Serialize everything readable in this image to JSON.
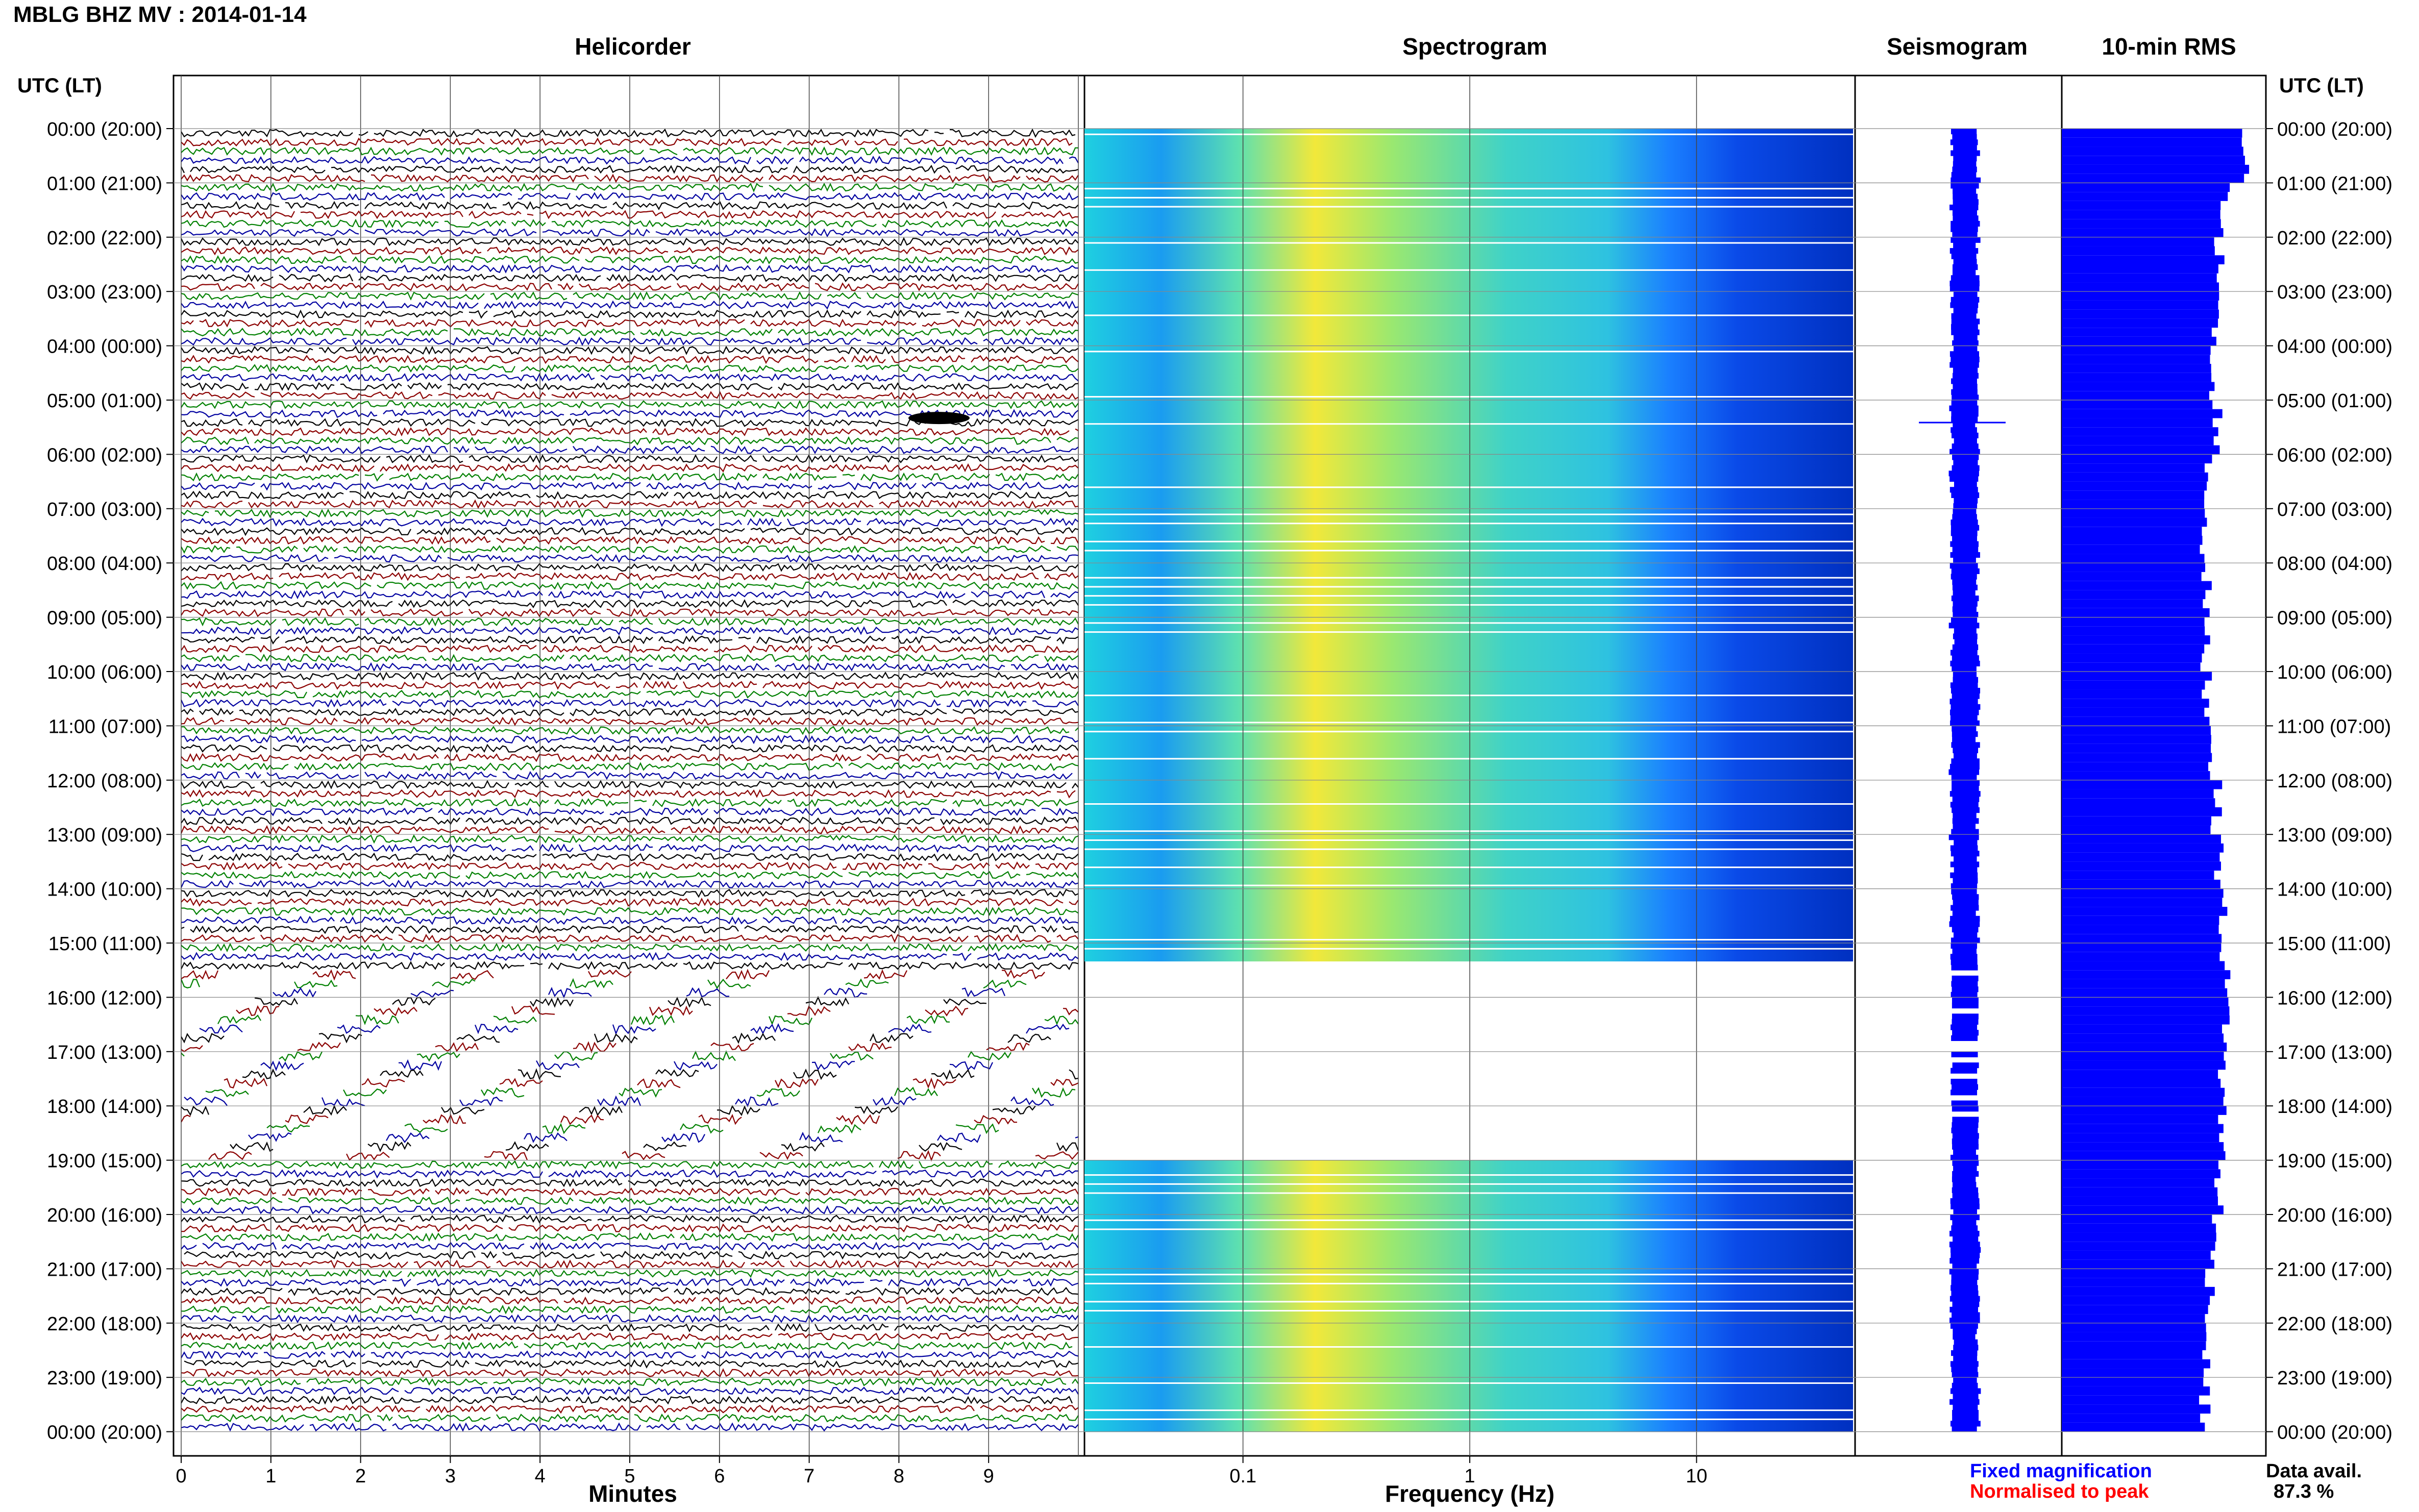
{
  "header": {
    "title": "MBLG BHZ MV : 2014-01-14"
  },
  "panels": {
    "helicorder": "Helicorder",
    "spectrogram": "Spectrogram",
    "seismogram": "Seismogram",
    "rms": "10-min RMS"
  },
  "axes": {
    "time_header": "UTC (LT)",
    "minutes_label": "Minutes",
    "frequency_label": "Frequency (Hz)",
    "minute_ticks": [
      "0",
      "1",
      "2",
      "3",
      "4",
      "5",
      "6",
      "7",
      "8",
      "9"
    ],
    "frequency_ticks": [
      "0.1",
      "1",
      "10"
    ],
    "time_labels": [
      "00:00 (20:00)",
      "01:00 (21:00)",
      "02:00 (22:00)",
      "03:00 (23:00)",
      "04:00 (00:00)",
      "05:00 (01:00)",
      "06:00 (02:00)",
      "07:00 (03:00)",
      "08:00 (04:00)",
      "09:00 (05:00)",
      "10:00 (06:00)",
      "11:00 (07:00)",
      "12:00 (08:00)",
      "13:00 (09:00)",
      "14:00 (10:00)",
      "15:00 (11:00)",
      "16:00 (12:00)",
      "17:00 (13:00)",
      "18:00 (14:00)",
      "19:00 (15:00)",
      "20:00 (16:00)",
      "21:00 (17:00)",
      "22:00 (18:00)",
      "23:00 (19:00)",
      "00:00 (20:00)"
    ]
  },
  "legend": {
    "fixed": "Fixed magnification",
    "normalised": "Normalised to peak",
    "fixed_color": "#0000ff",
    "normalised_color": "#ff0000",
    "availability_label": "Data avail.",
    "availability_value": "87.3 %"
  },
  "colors": {
    "trace_cycle": [
      "#000000",
      "#8b0000",
      "#008000",
      "#0000a0"
    ],
    "bar": "#0000ff"
  },
  "chart_data": {
    "type": "heatmap",
    "helicorder": {
      "x_range_minutes": [
        0,
        10
      ],
      "row_minutes": 10,
      "rows": 144,
      "gap_start_hour": 15.5,
      "gap_end_hour": 18.9
    },
    "spectrogram": {
      "x_scale": "log",
      "x_range_hz": [
        0.02,
        50
      ],
      "peak_band_hz": [
        0.2,
        0.3
      ],
      "missing_hours": [
        [
          15.3,
          18.9
        ]
      ]
    },
    "rms": {
      "interval_minutes": 10,
      "values_by_hour": [
        1.25,
        1.12,
        1.08,
        1.05,
        1.02,
        1.07,
        1.0,
        0.98,
        0.99,
        0.98,
        1.0,
        1.04,
        1.06,
        1.08,
        1.1,
        1.12,
        1.13,
        1.1,
        1.1,
        1.08,
        1.04,
        1.02,
        0.99,
        0.98,
        0.96
      ]
    }
  }
}
